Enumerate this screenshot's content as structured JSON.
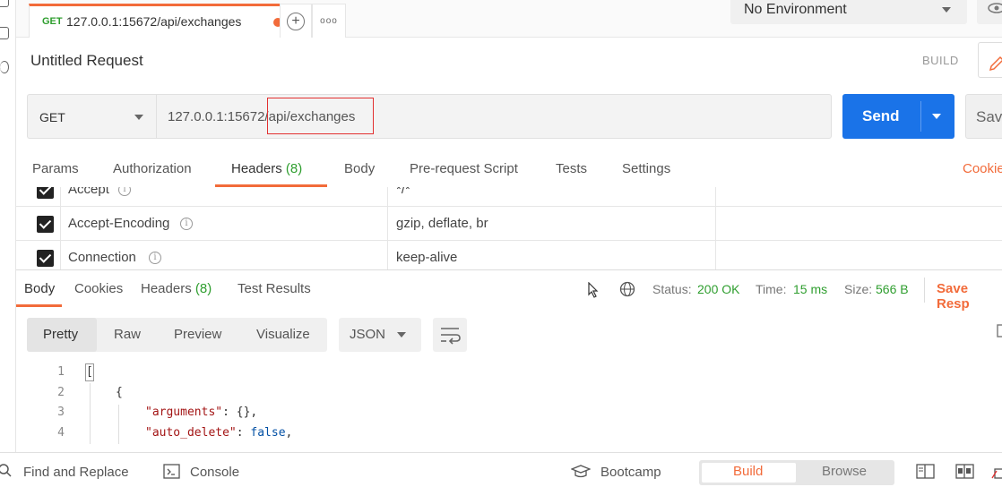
{
  "tabs": {
    "active": {
      "method": "GET",
      "url": "127.0.0.1:15672/api/exchanges"
    },
    "more_label": "ooo"
  },
  "environment": {
    "selected": "No Environment"
  },
  "request": {
    "title": "Untitled Request",
    "mode_label": "BUILD",
    "method": "GET",
    "url": "127.0.0.1:15672/api/exchanges",
    "send_label": "Send",
    "save_label": "Sav"
  },
  "request_tabs": {
    "params": "Params",
    "authorization": "Authorization",
    "headers": "Headers",
    "headers_count": "(8)",
    "body": "Body",
    "prerequest": "Pre-request Script",
    "tests": "Tests",
    "settings": "Settings",
    "cookies": "Cookie"
  },
  "headers": [
    {
      "key": "Accept",
      "value": "*/*",
      "checked": true
    },
    {
      "key": "Accept-Encoding",
      "value": "gzip, deflate, br",
      "checked": true
    },
    {
      "key": "Connection",
      "value": "keep-alive",
      "checked": true
    }
  ],
  "response": {
    "tabs": {
      "body": "Body",
      "cookies": "Cookies",
      "headers": "Headers",
      "headers_count": "(8)",
      "tests": "Test Results"
    },
    "status_label": "Status:",
    "status_value": "200 OK",
    "time_label": "Time:",
    "time_value": "15 ms",
    "size_label": "Size:",
    "size_value": "566 B",
    "save_label": "Save Resp"
  },
  "formats": {
    "pretty": "Pretty",
    "raw": "Raw",
    "preview": "Preview",
    "visualize": "Visualize",
    "lang": "JSON"
  },
  "code": {
    "line_numbers": [
      "1",
      "2",
      "3",
      "4"
    ],
    "line1": "[",
    "line2": "{",
    "key3": "\"arguments\"",
    "rest3": ": {},",
    "key4": "\"auto_delete\"",
    "colon4": ": ",
    "val4": "false",
    "comma4": ","
  },
  "footer": {
    "find": "Find and Replace",
    "console": "Console",
    "bootcamp": "Bootcamp",
    "build": "Build",
    "browse": "Browse"
  },
  "colors": {
    "accent": "#f26b3a",
    "primary": "#1a73e8",
    "success": "#2f9e2f"
  }
}
